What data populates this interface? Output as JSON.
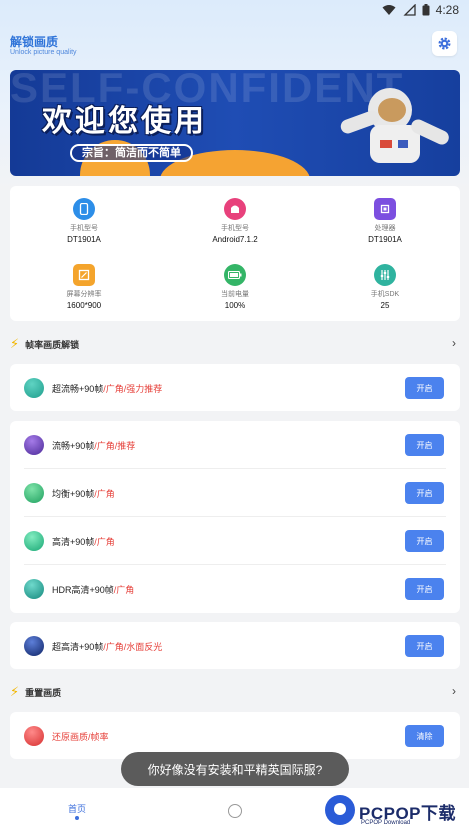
{
  "status_bar": {
    "time": "4:28"
  },
  "header": {
    "title": "解锁画质",
    "subtitle": "Unlock picture quality"
  },
  "banner": {
    "headline": "欢迎您使用",
    "slogan": "宗旨：简洁而不简单",
    "background_text": "SELF-CONFIDENT"
  },
  "device_info": [
    {
      "label": "手机型号",
      "value": "DT1901A",
      "icon": "phone-icon",
      "color": "#2d8ee8"
    },
    {
      "label": "手机型号",
      "value": "Android7.1.2",
      "icon": "android-icon",
      "color": "#e8417c"
    },
    {
      "label": "处理器",
      "value": "DT1901A",
      "icon": "cpu-icon",
      "color": "#7c4fe0"
    },
    {
      "label": "屏幕分辨率",
      "value": "1600*900",
      "icon": "screen-icon",
      "color": "#f4a42c"
    },
    {
      "label": "当前电量",
      "value": "100%",
      "icon": "battery-icon",
      "color": "#34b567"
    },
    {
      "label": "手机SDK",
      "value": "25",
      "icon": "sliders-icon",
      "color": "#2fb39f"
    }
  ],
  "section_unlock": {
    "title": "帧率画质解锁"
  },
  "rows_group1": [
    {
      "name": "超流畅+90帧",
      "tag": "/广角/强力推荐",
      "button": "开启",
      "color": "#1f9e8c"
    }
  ],
  "rows_group2": [
    {
      "name": "流畅+90帧",
      "tag": "/广角/推荐",
      "button": "开启",
      "color": "#6a3fb8"
    },
    {
      "name": "均衡+90帧",
      "tag": "/广角",
      "button": "开启",
      "color": "#2bb874"
    },
    {
      "name": "高清+90帧",
      "tag": "/广角",
      "button": "开启",
      "color": "#2ab986"
    },
    {
      "name": "HDR高清+90帧",
      "tag": "/广角",
      "button": "开启",
      "color": "#1fa192"
    }
  ],
  "rows_group3": [
    {
      "name": "超高清+90帧",
      "tag": "/广角/水面反光",
      "button": "开启",
      "color": "#1d3b8f"
    }
  ],
  "section_reset": {
    "title": "重置画质"
  },
  "reset_row": {
    "name": "还原画质/帧率",
    "button": "清除",
    "color": "#e84a4a"
  },
  "toast": "你好像没有安装和平精英国际服?",
  "bottom_nav": {
    "home_label": "首页"
  },
  "watermark": {
    "text": "PCPOP下载",
    "sub": "PCPOP Download"
  }
}
